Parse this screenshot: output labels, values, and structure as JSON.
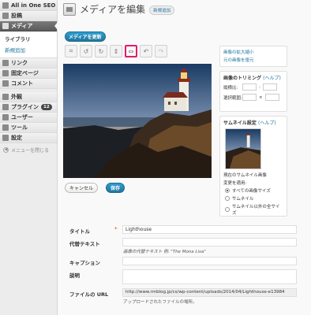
{
  "sidebar": {
    "top_item": "All in One SEO",
    "items": [
      {
        "label": "投稿",
        "icon": "pin-icon"
      },
      {
        "label": "メディア",
        "icon": "media-icon",
        "current": true
      },
      {
        "label": "リンク",
        "icon": "link-icon"
      },
      {
        "label": "固定ページ",
        "icon": "page-icon"
      },
      {
        "label": "コメント",
        "icon": "comment-icon"
      },
      {
        "label": "外観",
        "icon": "appearance-icon"
      },
      {
        "label": "プラグイン",
        "icon": "plugin-icon",
        "badge": "12"
      },
      {
        "label": "ユーザー",
        "icon": "users-icon"
      },
      {
        "label": "ツール",
        "icon": "tools-icon"
      },
      {
        "label": "設定",
        "icon": "settings-icon"
      }
    ],
    "submenu": [
      "ライブラリ",
      "新規追加"
    ],
    "collapse_label": "メニューを閉じる"
  },
  "header": {
    "title": "メディアを編集",
    "add_new": "新規追加"
  },
  "update_button": "メディアを更新",
  "toolbar": {
    "buttons": [
      "crop-icon",
      "rotate-left-icon",
      "rotate-right-icon",
      "flip-vertical-icon",
      "flip-horizontal-icon",
      "undo-icon",
      "redo-icon"
    ]
  },
  "image_buttons": {
    "cancel": "キャンセル",
    "save": "保存"
  },
  "panels": {
    "scale": {
      "link1": "画像の拡大縮小",
      "link2": "元の画像を復元"
    },
    "crop": {
      "title": "画像のトリミング",
      "help": "(ヘルプ)",
      "ratio_label": "縦横比:",
      "selection_label": "選択範囲:",
      "sep": ":",
      "sep2": "×"
    },
    "thumbnail": {
      "title": "サムネイル設定",
      "help": "(ヘルプ)",
      "current_label": "現在のサムネイル画像",
      "apply_label": "変更を適用:",
      "options": [
        "すべての画像サイズ",
        "サムネイル",
        "サムネイル以外の全サイズ"
      ]
    }
  },
  "fields": {
    "title_label": "タイトル",
    "title_value": "Lighthouse",
    "required_mark": "*",
    "alt_label": "代替テキスト",
    "alt_hint": "画像の代替テキスト 例: \"The Mona Lisa\"",
    "caption_label": "キャプション",
    "description_label": "説明",
    "url_label": "ファイルの URL",
    "url_value": "http://www.rmblog.jp/cs/wp-content/uploads/2014/04/Lighthouse-e13984",
    "url_hint": "アップロードされたファイルの場所。"
  },
  "colors": {
    "accent": "#21759b",
    "highlight": "#e61a6a",
    "menu_current": "#5b5b5b"
  }
}
